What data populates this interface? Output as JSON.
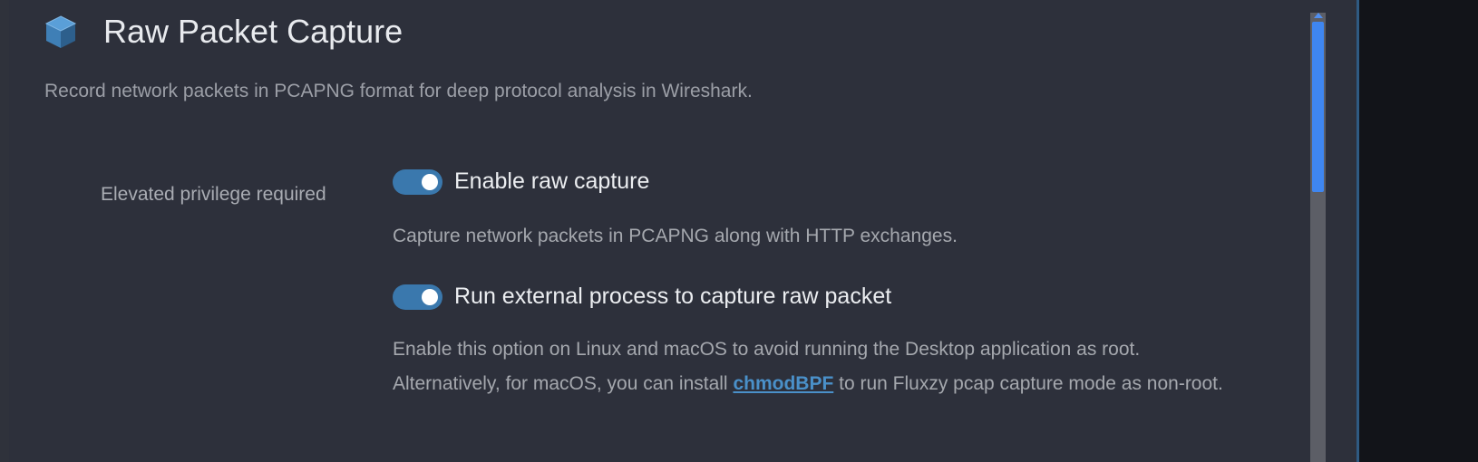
{
  "section": {
    "icon": "cube-icon",
    "title": "Raw Packet Capture",
    "subtitle": "Record network packets in PCAPNG format for deep protocol analysis in Wireshark."
  },
  "privilege_label": "Elevated privilege required",
  "options": [
    {
      "label": "Enable raw capture",
      "enabled": true,
      "description": "Capture network packets in PCAPNG along with HTTP exchanges."
    },
    {
      "label": "Run external process to capture raw packet",
      "enabled": true,
      "description_line1": "Enable this option on Linux and macOS to avoid running the Desktop application as root.",
      "description_pre_link": "Alternatively, for macOS, you can install ",
      "link_text": "chmodBPF",
      "description_post_link": " to run Fluxzy pcap capture mode as non-root."
    }
  ],
  "colors": {
    "accent": "#3a78ad",
    "link": "#4a90c9",
    "panel_bg": "#2d303b",
    "scroll_thumb": "#3f86f0"
  }
}
